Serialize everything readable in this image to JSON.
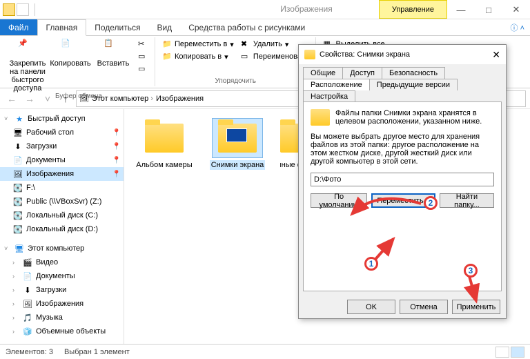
{
  "titlebar": {
    "context_tab": "Управление",
    "context_group": "Средства работы с рисунками",
    "window_title": "Изображения"
  },
  "ribbon_tabs": {
    "file": "Файл",
    "home": "Главная",
    "share": "Поделиться",
    "view": "Вид",
    "pictools": "Средства работы с рисунками"
  },
  "ribbon": {
    "pin": "Закрепить на панели быстрого доступа",
    "copy": "Копировать",
    "paste": "Вставить",
    "clipboard_group": "Буфер обмена",
    "move_to": "Переместить в",
    "copy_to": "Копировать в",
    "delete": "Удалить",
    "rename": "Переименовать",
    "organize_group": "Упорядочить",
    "select_all": "Выделить все"
  },
  "breadcrumb": {
    "this_pc": "Этот компьютер",
    "pictures": "Изображения"
  },
  "nav": {
    "quick": "Быстрый доступ",
    "desktop": "Рабочий стол",
    "downloads": "Загрузки",
    "documents": "Документы",
    "pictures": "Изображения",
    "f": "F:\\",
    "public": "Public (\\\\VBoxSvr) (Z:)",
    "localc": "Локальный диск (C:)",
    "locald": "Локальный диск (D:)",
    "thispc": "Этот компьютер",
    "video": "Видео",
    "documents2": "Документы",
    "downloads2": "Загрузки",
    "pictures2": "Изображения",
    "music": "Музыка",
    "objects3d": "Объемные объекты"
  },
  "folders": {
    "camera": "Альбом камеры",
    "screenshots": "Снимки экрана",
    "saved": "Сохраненные фотографии"
  },
  "status": {
    "elements": "Элементов: 3",
    "selected": "Выбран 1 элемент"
  },
  "dialog": {
    "title": "Свойства: Снимки экрана",
    "tabs": {
      "general": "Общие",
      "sharing": "Доступ",
      "security": "Безопасность",
      "location": "Расположение",
      "prev": "Предыдущие версии",
      "customize": "Настройка"
    },
    "desc1": "Файлы папки Снимки экрана хранятся в целевом расположении, указанном ниже.",
    "desc2": "Вы можете выбрать другое место для хранения файлов из этой папки: другое расположение на этом жестком диске, другой жесткий диск или другой компьютер в этой сети.",
    "path": "D:\\Фото",
    "restore": "По умолчанию",
    "move": "Переместить...",
    "find": "Найти папку...",
    "ok": "OK",
    "cancel": "Отмена",
    "apply": "Применить"
  },
  "badges": {
    "b1": "1",
    "b2": "2",
    "b3": "3"
  }
}
